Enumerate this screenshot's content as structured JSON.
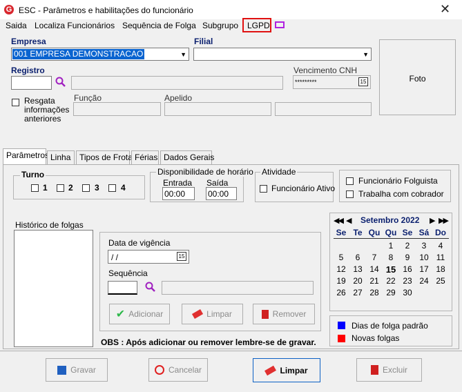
{
  "window": {
    "title": "ESC - Parâmetros e habilitações do funcionário",
    "close_glyph": "✕"
  },
  "menu": {
    "saida": "Saida",
    "localiza": "Localiza Funcionários",
    "sequencia": "Sequência de Folga",
    "subgrupo": "Subgrupo",
    "lgpd": "LGPD"
  },
  "header": {
    "empresa_label": "Empresa",
    "empresa_value": "001 EMPRESA DEMONSTRACAO",
    "filial_label": "Filial",
    "registro_label": "Registro",
    "vencimento_label": "Vencimento  CNH",
    "vencimento_value": "*********",
    "resgata_label": "Resgata informações anteriores",
    "funcao_label": "Função",
    "apelido_label": "Apelido",
    "foto_label": "Foto"
  },
  "tabs": [
    "Parâmetros",
    "Linha",
    "Tipos de Frota",
    "Férias",
    "Dados Gerais"
  ],
  "turno": {
    "title": "Turno",
    "options": [
      "1",
      "2",
      "3",
      "4"
    ]
  },
  "disponibilidade": {
    "title": "Disponibilidade de horário",
    "entrada_label": "Entrada",
    "entrada_value": "00:00",
    "saida_label": "Saída",
    "saida_value": "00:00"
  },
  "atividade": {
    "title": "Atividade",
    "ativo_label": "Funcionário Ativo"
  },
  "flags": {
    "folguista": "Funcionário Folguista",
    "cobrador": "Trabalha com cobrador"
  },
  "historico": {
    "title": "Histórico de folgas",
    "vigencia_label": "Data de vigência",
    "vigencia_value": " /  /",
    "sequencia_label": "Sequência",
    "btn_adicionar": "Adicionar",
    "btn_limpar": "Limpar",
    "btn_remover": "Remover",
    "obs": "OBS : Após adicionar ou  remover lembre-se de gravar."
  },
  "calendar": {
    "month_title": "Setembro 2022",
    "weekdays": [
      "Se",
      "Te",
      "Qu",
      "Qu",
      "Se",
      "Sá",
      "Do"
    ],
    "today": 15,
    "weeks": [
      [
        "",
        "",
        "",
        "1",
        "2",
        "3",
        "4"
      ],
      [
        "5",
        "6",
        "7",
        "8",
        "9",
        "10",
        "11"
      ],
      [
        "12",
        "13",
        "14",
        "15",
        "16",
        "17",
        "18"
      ],
      [
        "19",
        "20",
        "21",
        "22",
        "23",
        "24",
        "25"
      ],
      [
        "26",
        "27",
        "28",
        "29",
        "30",
        "",
        ""
      ]
    ],
    "legend": [
      {
        "label": "Dias de folga padrão",
        "color": "#0000ff"
      },
      {
        "label": "Novas folgas",
        "color": "#ff0000"
      }
    ]
  },
  "footer": {
    "gravar": "Gravar",
    "cancelar": "Cancelar",
    "limpar": "Limpar",
    "excluir": "Excluir"
  }
}
